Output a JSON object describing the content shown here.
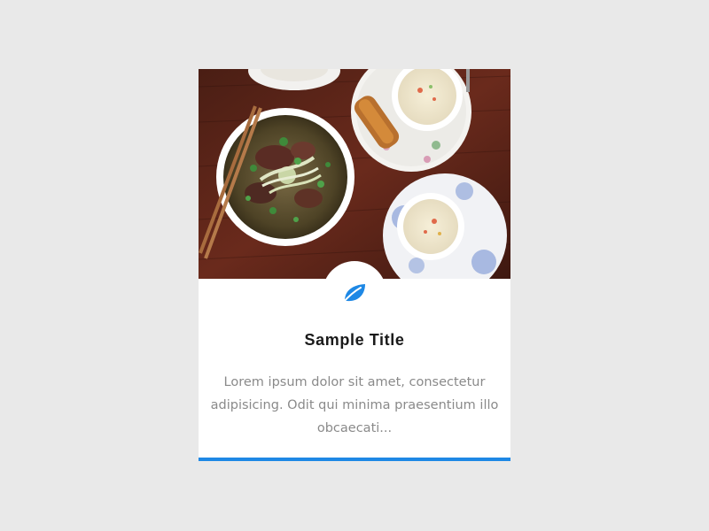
{
  "card": {
    "image_description_alt": "Bowls of pho, spring rolls and dipping sauces on a wooden table",
    "icon": "leaf-icon",
    "title": "Sample Title",
    "text": "Lorem ipsum dolor sit amet, consectetur adipisicing. Odit qui minima praesentium illo obcaecati...",
    "accent_color": "#1e88e5"
  }
}
